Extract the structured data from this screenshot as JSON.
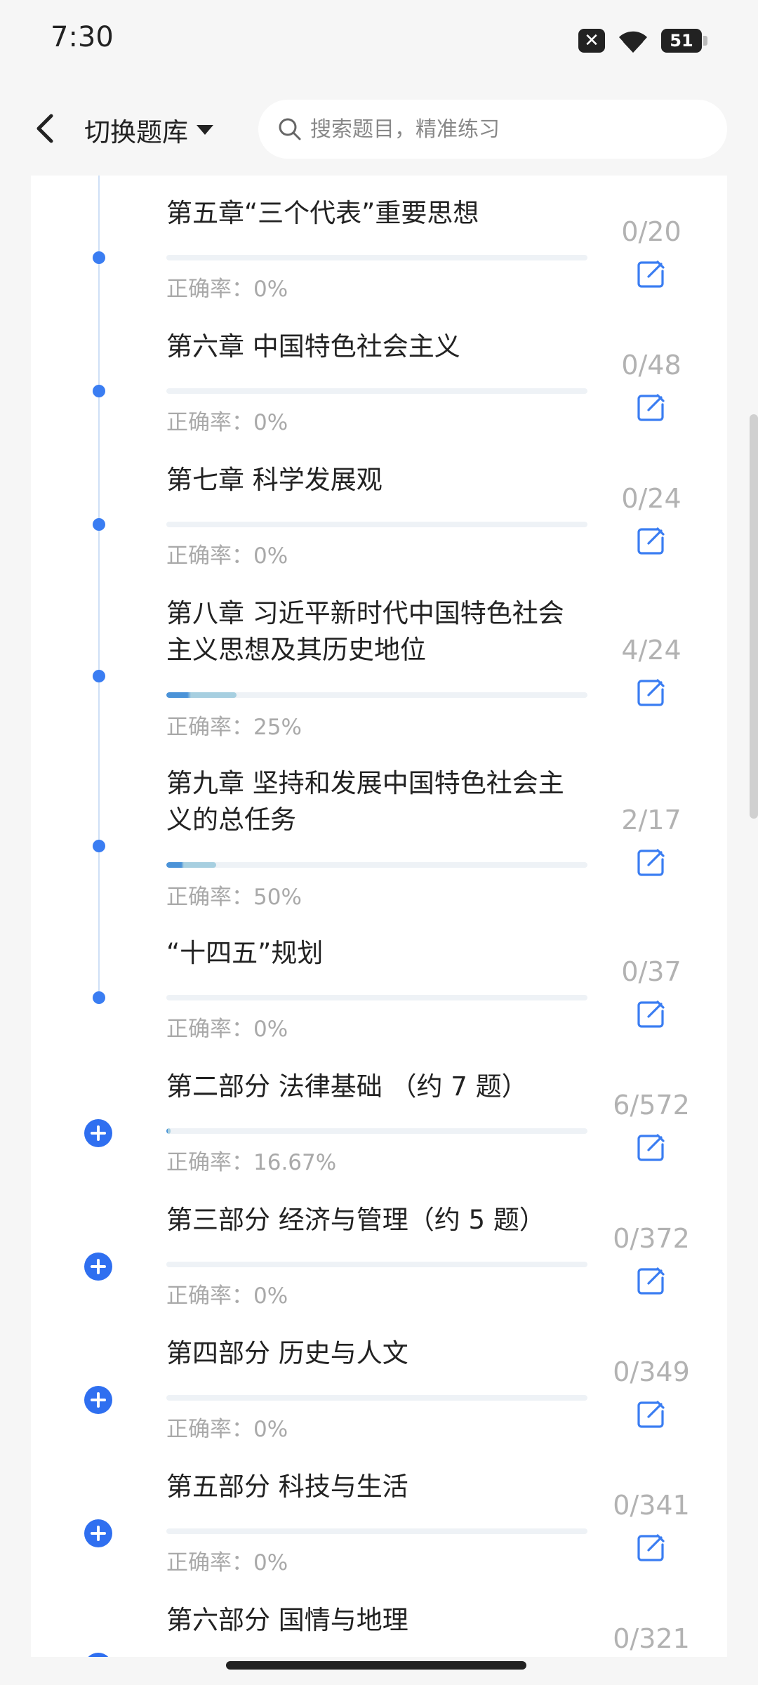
{
  "status": {
    "time": "7:30",
    "battery": "51",
    "icons": [
      "sim-error-icon",
      "wifi-icon",
      "battery-icon"
    ]
  },
  "header": {
    "title": "切换题库",
    "search_placeholder": "搜索题目，精准练习"
  },
  "colors": {
    "accent": "#3A7DF2",
    "text": "#222222",
    "muted": "#A9A9A9"
  },
  "items": [
    {
      "title": "第五章“三个代表”重要思想",
      "accuracy": "正确率：0%",
      "count": "0/20",
      "progress": 0,
      "type": "chapter"
    },
    {
      "title": "第六章 中国特色社会主义",
      "accuracy": "正确率：0%",
      "count": "0/48",
      "progress": 0,
      "type": "chapter"
    },
    {
      "title": "第七章 科学发展观",
      "accuracy": "正确率：0%",
      "count": "0/24",
      "progress": 0,
      "type": "chapter"
    },
    {
      "title": "第八章 习近平新时代中国特色社会主义思想及其历史地位",
      "accuracy": "正确率：25%",
      "count": "4/24",
      "progress": 0.1667,
      "type": "chapter"
    },
    {
      "title": "第九章 坚持和发展中国特色社会主义的总任务",
      "accuracy": "正确率：50%",
      "count": "2/17",
      "progress": 0.1176,
      "type": "chapter"
    },
    {
      "title": "“十四五”规划",
      "accuracy": "正确率：0%",
      "count": "0/37",
      "progress": 0,
      "type": "chapter"
    },
    {
      "title": "第二部分 法律基础 （约 7 题）",
      "accuracy": "正确率：16.67%",
      "count": "6/572",
      "progress": 0.0105,
      "type": "part"
    },
    {
      "title": "第三部分 经济与管理（约 5 题）",
      "accuracy": "正确率：0%",
      "count": "0/372",
      "progress": 0,
      "type": "part"
    },
    {
      "title": "第四部分 历史与人文",
      "accuracy": "正确率：0%",
      "count": "0/349",
      "progress": 0,
      "type": "part"
    },
    {
      "title": "第五部分 科技与生活",
      "accuracy": "正确率：0%",
      "count": "0/341",
      "progress": 0,
      "type": "part"
    },
    {
      "title": "第六部分 国情与地理",
      "accuracy": "",
      "count": "0/321",
      "progress": 0,
      "type": "part"
    }
  ]
}
